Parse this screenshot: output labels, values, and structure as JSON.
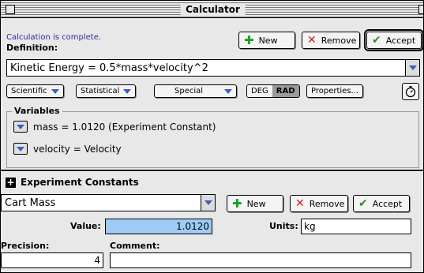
{
  "window": {
    "title": "Calculator"
  },
  "header": {
    "status": "Calculation is complete.",
    "definition_label": "Definition:",
    "buttons": {
      "new": "New",
      "remove": "Remove",
      "accept": "Accept"
    }
  },
  "definition": {
    "value": "Kinetic Energy = 0.5*mass*velocity^2"
  },
  "toolbar": {
    "popups": [
      "Scientific",
      "Statistical",
      "Special"
    ],
    "angle_modes": [
      "DEG",
      "RAD"
    ],
    "angle_selected": "RAD",
    "properties": "Properties..."
  },
  "variables": {
    "label": "Variables",
    "items": [
      "mass = 1.0120 (Experiment Constant)",
      "velocity = Velocity"
    ]
  },
  "constants": {
    "label": "Experiment Constants",
    "selected": "Cart Mass",
    "buttons": {
      "new": "New",
      "remove": "Remove",
      "accept": "Accept"
    },
    "value_label": "Value:",
    "value": "1.0120",
    "units_label": "Units:",
    "units": "kg",
    "precision_label": "Precision:",
    "precision": "4",
    "comment_label": "Comment:",
    "comment": ""
  },
  "colors": {
    "plus": "#1a9e2a",
    "remove": "#d41a1a",
    "accept": "#2b8a2b",
    "selection": "#9ecbf5",
    "status": "#2a2aa0"
  }
}
